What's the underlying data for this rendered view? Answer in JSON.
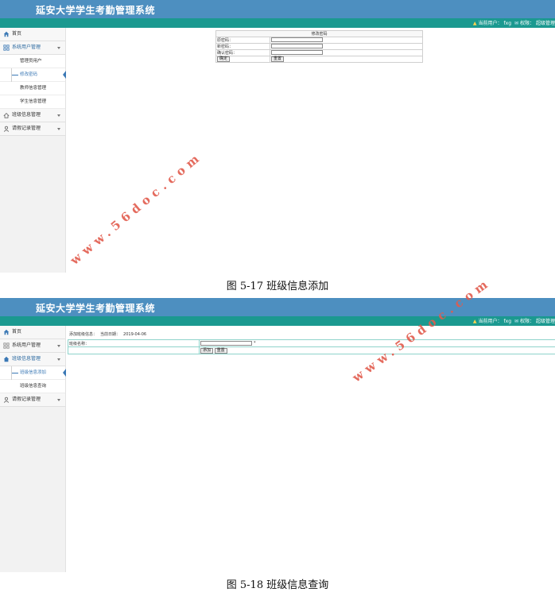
{
  "app_title": "延安大学学生考勤管理系统",
  "topbar": {
    "current_user_label": "当前用户：",
    "username": "fxg",
    "role_label": "权限：",
    "role": "超级管理"
  },
  "watermark": "www.56doc.com",
  "screen1": {
    "menu": {
      "home": "首页",
      "sys_users": "系统用户管理",
      "sub_admin": "管理员用户",
      "sub_change_pwd": "修改密码",
      "sub_teacher": "教师信息管理",
      "sub_student": "学生信息管理",
      "class_mgmt": "班级信息管理",
      "leave_mgmt": "请假记录管理"
    },
    "form": {
      "heading": "修改密码",
      "old_pwd_label": "原密码：",
      "new_pwd_label": "新密码：",
      "confirm_pwd_label": "确认密码：",
      "ok_button": "确定",
      "reset_button": "重置"
    },
    "caption": "图 5-17 班级信息添加"
  },
  "screen2": {
    "menu": {
      "home": "首页",
      "sys_users": "系统用户管理",
      "class_mgmt": "班级信息管理",
      "sub_class_add": "班级信息添加",
      "sub_class_query": "班级信息查询",
      "leave_mgmt": "请假记录管理"
    },
    "breadcrumb": {
      "label": "添加班级信息：",
      "date_label": "当前日期：",
      "date": "2019-04-06"
    },
    "form": {
      "class_name_label": "班级名称：",
      "required_mark": "*",
      "add_button": "添加",
      "reset_button": "重置"
    },
    "caption": "图 5-18 班级信息查询"
  },
  "colors": {
    "header_bg": "#4d8fc0",
    "topbar_bg": "#1b9990",
    "accent": "#3a78b5",
    "watermark": "#e25b4d"
  },
  "icons": [
    "home-icon",
    "grid-icon",
    "house-icon",
    "person-icon",
    "user-icon",
    "edit-icon"
  ]
}
